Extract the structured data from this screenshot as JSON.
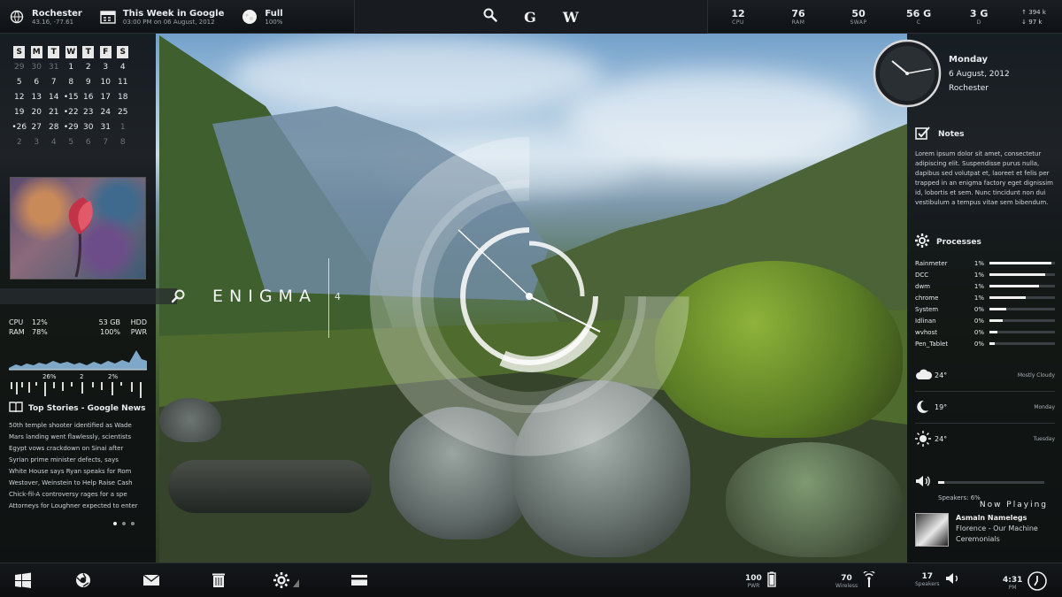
{
  "topbar": {
    "weather": {
      "title": "Rochester",
      "sub": "43.16, -77.61"
    },
    "events": {
      "title": "This Week in Google",
      "sub": "03:00 PM on 06 August, 2012"
    },
    "moon": {
      "title": "Full",
      "sub": "100%"
    },
    "center": {
      "g_glyph": "G",
      "w_glyph": "W"
    },
    "stats": [
      {
        "value": "12",
        "label": "CPU"
      },
      {
        "value": "76",
        "label": "RAM"
      },
      {
        "value": "50",
        "label": "SWAP"
      },
      {
        "value": "56 G",
        "label": "C"
      },
      {
        "value": "3 G",
        "label": "D"
      }
    ],
    "net": {
      "up": "↑ 394 k",
      "down": "↓ 97 k"
    }
  },
  "calendar": {
    "headers": [
      "S",
      "M",
      "T",
      "W",
      "T",
      "F",
      "S"
    ],
    "days": [
      [
        "29",
        "30",
        "31",
        "1",
        "2",
        "3",
        "4"
      ],
      [
        "5",
        "6",
        "7",
        "8",
        "9",
        "10",
        "11"
      ],
      [
        "12",
        "13",
        "14",
        "•15",
        "16",
        "17",
        "18"
      ],
      [
        "19",
        "20",
        "21",
        "•22",
        "23",
        "24",
        "25"
      ],
      [
        "•26",
        "27",
        "28",
        "•29",
        "30",
        "31",
        "1"
      ],
      [
        "2",
        "3",
        "4",
        "5",
        "6",
        "7",
        "8"
      ]
    ]
  },
  "system": {
    "cpu_label": "CPU",
    "cpu_value": "12%",
    "hdd_value": "53 GB",
    "hdd_label": "HDD",
    "ram_label": "RAM",
    "ram_value": "78%",
    "pwr_value": "100%",
    "pwr_label": "PWR",
    "graph_left": "26%",
    "graph_mid": "2",
    "graph_right": "2%"
  },
  "news": {
    "title": "Top Stories - Google News",
    "items": [
      "50th temple shooter identified as Wade",
      "Mars landing went flawlessly, scientists",
      "Egypt vows crackdown on Sinai after",
      "Syrian prime minister defects, says",
      "White House says Ryan speaks for Rom",
      "Westover, Weinstein to Help Raise Cash",
      "Chick-fil-A controversy rages for a spe",
      "Attorneys for Loughner expected to enter"
    ]
  },
  "center": {
    "brand": "ENIGMA",
    "version": "4"
  },
  "clock": {
    "day": "Monday",
    "date": "6 August, 2012",
    "city": "Rochester"
  },
  "notes": {
    "title": "Notes",
    "text": "Lorem ipsum dolor sit amet, consectetur adipiscing elit. Suspendisse purus nulla, dapibus sed volutpat et, laoreet et felis per trapped in an enigma factory eget dignissim id, lobortis et sem. Nunc tincidunt non dui vestibulum a tempus vitae sem bibendum."
  },
  "processes": {
    "title": "Processes",
    "items": [
      {
        "name": "Rainmeter",
        "pct": "1%",
        "fill": 0.95
      },
      {
        "name": "DCC",
        "pct": "1%",
        "fill": 0.85
      },
      {
        "name": "dwm",
        "pct": "1%",
        "fill": 0.75
      },
      {
        "name": "chrome",
        "pct": "1%",
        "fill": 0.55
      },
      {
        "name": "System",
        "pct": "0%",
        "fill": 0.25
      },
      {
        "name": "Idlinan",
        "pct": "0%",
        "fill": 0.2
      },
      {
        "name": "wvhost",
        "pct": "0%",
        "fill": 0.12
      },
      {
        "name": "Pen_Tablet",
        "pct": "0%",
        "fill": 0.08
      }
    ]
  },
  "weather": [
    {
      "icon": "cloud-icon",
      "temp": "24°",
      "desc": "Mostly Cloudy"
    },
    {
      "icon": "moon-icon",
      "temp": "19°",
      "desc": "Monday"
    },
    {
      "icon": "sun-icon",
      "temp": "24°",
      "desc": "Tuesday"
    }
  ],
  "volume": {
    "label": "Speakers: 6%",
    "level": 0.06
  },
  "now_playing": {
    "title": "Now Playing",
    "artist": "Asmaln Namelegs",
    "track": "Florence - Our Machine",
    "album": "Ceremonials"
  },
  "bottombar": {
    "stats": [
      {
        "value": "100",
        "label": "PWR"
      },
      {
        "value": "70",
        "label": "Wireless"
      },
      {
        "value": "17",
        "label": "Speakers"
      },
      {
        "value": "4:31",
        "label": "PM"
      }
    ]
  }
}
